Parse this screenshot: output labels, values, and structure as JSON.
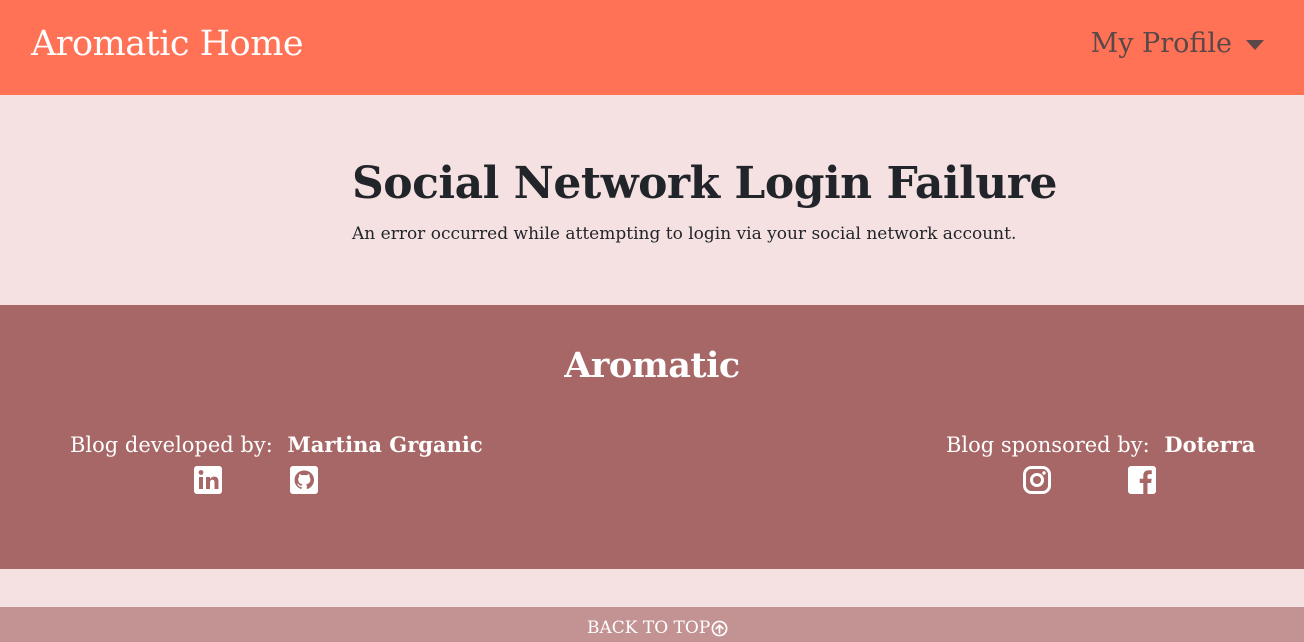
{
  "navbar": {
    "brand": "Aromatic Home",
    "profile_label": "My Profile",
    "profile_icon": "caret-down-icon",
    "background": "#ff7256"
  },
  "main": {
    "title": "Social Network Login Failure",
    "message": "An error occurred while attempting to login via your social network account."
  },
  "footer": {
    "title": "Aromatic",
    "developer": {
      "label": "Blog developed by:",
      "name": "Martina Grganic",
      "icons": [
        "linkedin-icon",
        "github-icon"
      ]
    },
    "sponsor": {
      "label": "Blog sponsored by:",
      "name": "Doterra",
      "icons": [
        "instagram-icon",
        "facebook-icon"
      ]
    },
    "background": "#a76767"
  },
  "back_to_top": {
    "label": "BACK TO TOP",
    "icon": "arrow-up-circle-icon",
    "background": "#c39393"
  },
  "colors": {
    "page_background": "#f5e1e1",
    "text_dark": "#212529",
    "text_light": "#ffffff"
  }
}
